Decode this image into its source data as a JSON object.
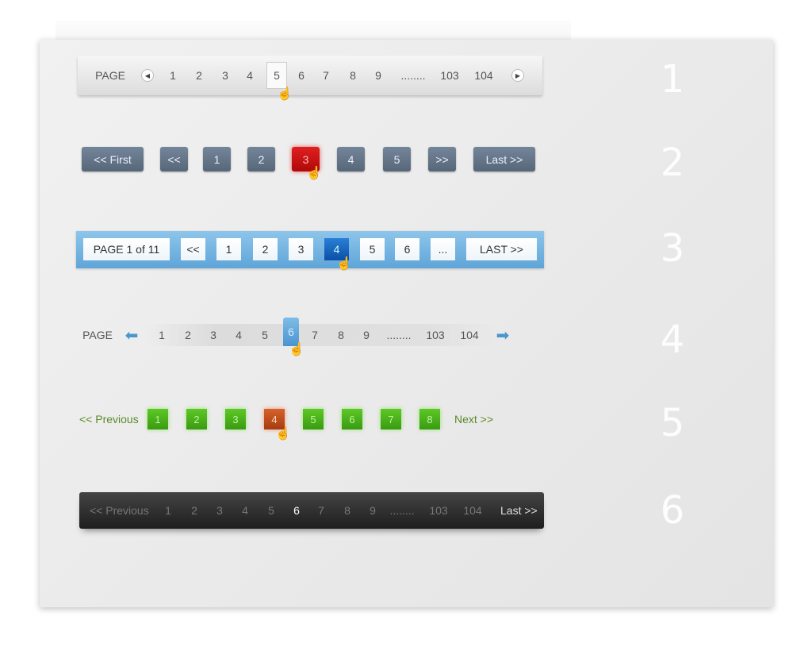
{
  "row_numbers": [
    "1",
    "2",
    "3",
    "4",
    "5",
    "6"
  ],
  "colors": {
    "red_active": "#c81010",
    "blue_bar": "#6aaee0",
    "blue_active": "#1a68c0",
    "green": "#4cb01c",
    "orange_active": "#c24e1c",
    "dark_bar": "#2a2a2a"
  },
  "pager1": {
    "label": "PAGE",
    "prev_icon": "circle-arrow-left-icon",
    "next_icon": "circle-arrow-right-icon",
    "pages": [
      "1",
      "2",
      "3",
      "4",
      "5",
      "6",
      "7",
      "8",
      "9",
      "........",
      "103",
      "104"
    ],
    "active": "5"
  },
  "pager2": {
    "items": [
      "<< First",
      "<<",
      "1",
      "2",
      "3",
      "4",
      "5",
      ">>",
      "Last >>"
    ],
    "active": "3"
  },
  "pager3": {
    "items": [
      "PAGE 1 of 11",
      "<<",
      "1",
      "2",
      "3",
      "4",
      "5",
      "6",
      "...",
      "LAST >>"
    ],
    "active": "4"
  },
  "pager4": {
    "label": "PAGE",
    "prev_icon": "arrow-left-icon",
    "next_icon": "arrow-right-icon",
    "pages": [
      "1",
      "2",
      "3",
      "4",
      "5",
      "6",
      "7",
      "8",
      "9",
      "........",
      "103",
      "104"
    ],
    "active": "6"
  },
  "pager5": {
    "previous": "<< Previous",
    "pages": [
      "1",
      "2",
      "3",
      "4",
      "5",
      "6",
      "7",
      "8"
    ],
    "next": "Next >>",
    "active": "4"
  },
  "pager6": {
    "previous": "<< Previous",
    "pages": [
      "1",
      "2",
      "3",
      "4",
      "5",
      "6",
      "7",
      "8",
      "9",
      "........",
      "103",
      "104"
    ],
    "last": "Last >>",
    "active": "6"
  }
}
